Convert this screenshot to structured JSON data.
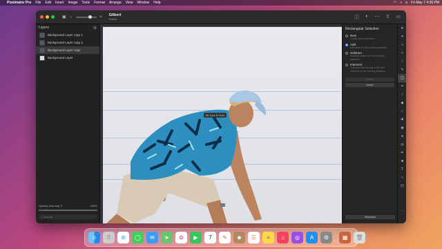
{
  "menubar": {
    "apple": "",
    "app": "Pixelmator Pro",
    "items": [
      "File",
      "Edit",
      "Insert",
      "Image",
      "Tools",
      "Format",
      "Arrange",
      "View",
      "Window",
      "Help"
    ],
    "datetime": "Fri May 7 4:36 PM"
  },
  "document": {
    "name": "Gilbert",
    "state": "Edited"
  },
  "layers": {
    "title": "Layers",
    "items": [
      {
        "label": "Background Layer copy 1"
      },
      {
        "label": "Background Layer copy 2"
      },
      {
        "label": "Background Layer copy"
      },
      {
        "label": "Background Layer"
      }
    ],
    "opacity_label": "Opacity (Normal) ⇕",
    "opacity_value": "100%",
    "search_placeholder": "Search"
  },
  "canvas": {
    "tooltip": "W: 4 px H: 0 px"
  },
  "inspector": {
    "title": "Rectangular Selection",
    "options": [
      {
        "label": "New",
        "desc": "Create a new selection",
        "selected": false
      },
      {
        "label": "Add",
        "desc": "Add areas to the existing selection",
        "selected": true
      },
      {
        "label": "Subtract",
        "desc": "Subtract areas from the existing selection",
        "selected": false
      },
      {
        "label": "Intersect",
        "desc": "Constrain the bounds of the new selection to the existing selection",
        "selected": false
      }
    ],
    "refine_label": "Refine",
    "invert_label": "Invert",
    "reselect_label": "Reselect"
  },
  "colors": {
    "accent": "#4a8bf5",
    "close": "#ff5f57",
    "minimize": "#febc2e",
    "zoom": "#28c840"
  }
}
